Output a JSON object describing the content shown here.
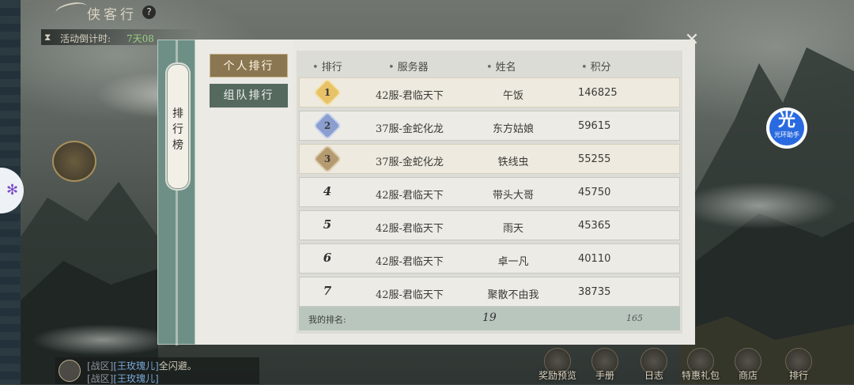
{
  "header": {
    "title": "侠客行",
    "help_icon": "?",
    "timer_label": "活动倒计时:",
    "timer_value": "7天08"
  },
  "panel": {
    "spine_title": "排行榜",
    "tabs": [
      {
        "label": "个人排行",
        "active": true
      },
      {
        "label": "组队排行",
        "active": false
      }
    ],
    "columns": [
      "排行",
      "服务器",
      "姓名",
      "积分"
    ],
    "rows": [
      {
        "rank": "1",
        "server": "42服-君临天下",
        "name": "午饭",
        "score": "146825"
      },
      {
        "rank": "2",
        "server": "37服-金蛇化龙",
        "name": "东方姑娘",
        "score": "59615"
      },
      {
        "rank": "3",
        "server": "37服-金蛇化龙",
        "name": "铁线虫",
        "score": "55255"
      },
      {
        "rank": "4",
        "server": "42服-君临天下",
        "name": "带头大哥",
        "score": "45750"
      },
      {
        "rank": "5",
        "server": "42服-君临天下",
        "name": "雨天",
        "score": "45365"
      },
      {
        "rank": "6",
        "server": "42服-君临天下",
        "name": "卓一凡",
        "score": "40110"
      },
      {
        "rank": "7",
        "server": "42服-君临天下",
        "name": "聚散不由我",
        "score": "38735"
      }
    ],
    "my_rank": {
      "label": "我的排名:",
      "position": "19",
      "points": "165"
    }
  },
  "chat": {
    "lines": [
      {
        "zone": "[战区]",
        "name": "[王玫瑰儿]",
        "text": "全闪避。"
      },
      {
        "zone": "[战区]",
        "name": "[王玫瑰儿]",
        "text": ""
      }
    ]
  },
  "assistant_badge": {
    "glyph": "光",
    "caption": "光环助手"
  },
  "bottom_nav": [
    "奖励预览",
    "手册",
    "日志",
    "特惠礼包",
    "商店",
    "排行"
  ],
  "colors": {
    "active_tab": "#8a7650",
    "inactive_tab": "#56695f",
    "spine": "#6e8f86",
    "badge": "#2a6ae0"
  }
}
